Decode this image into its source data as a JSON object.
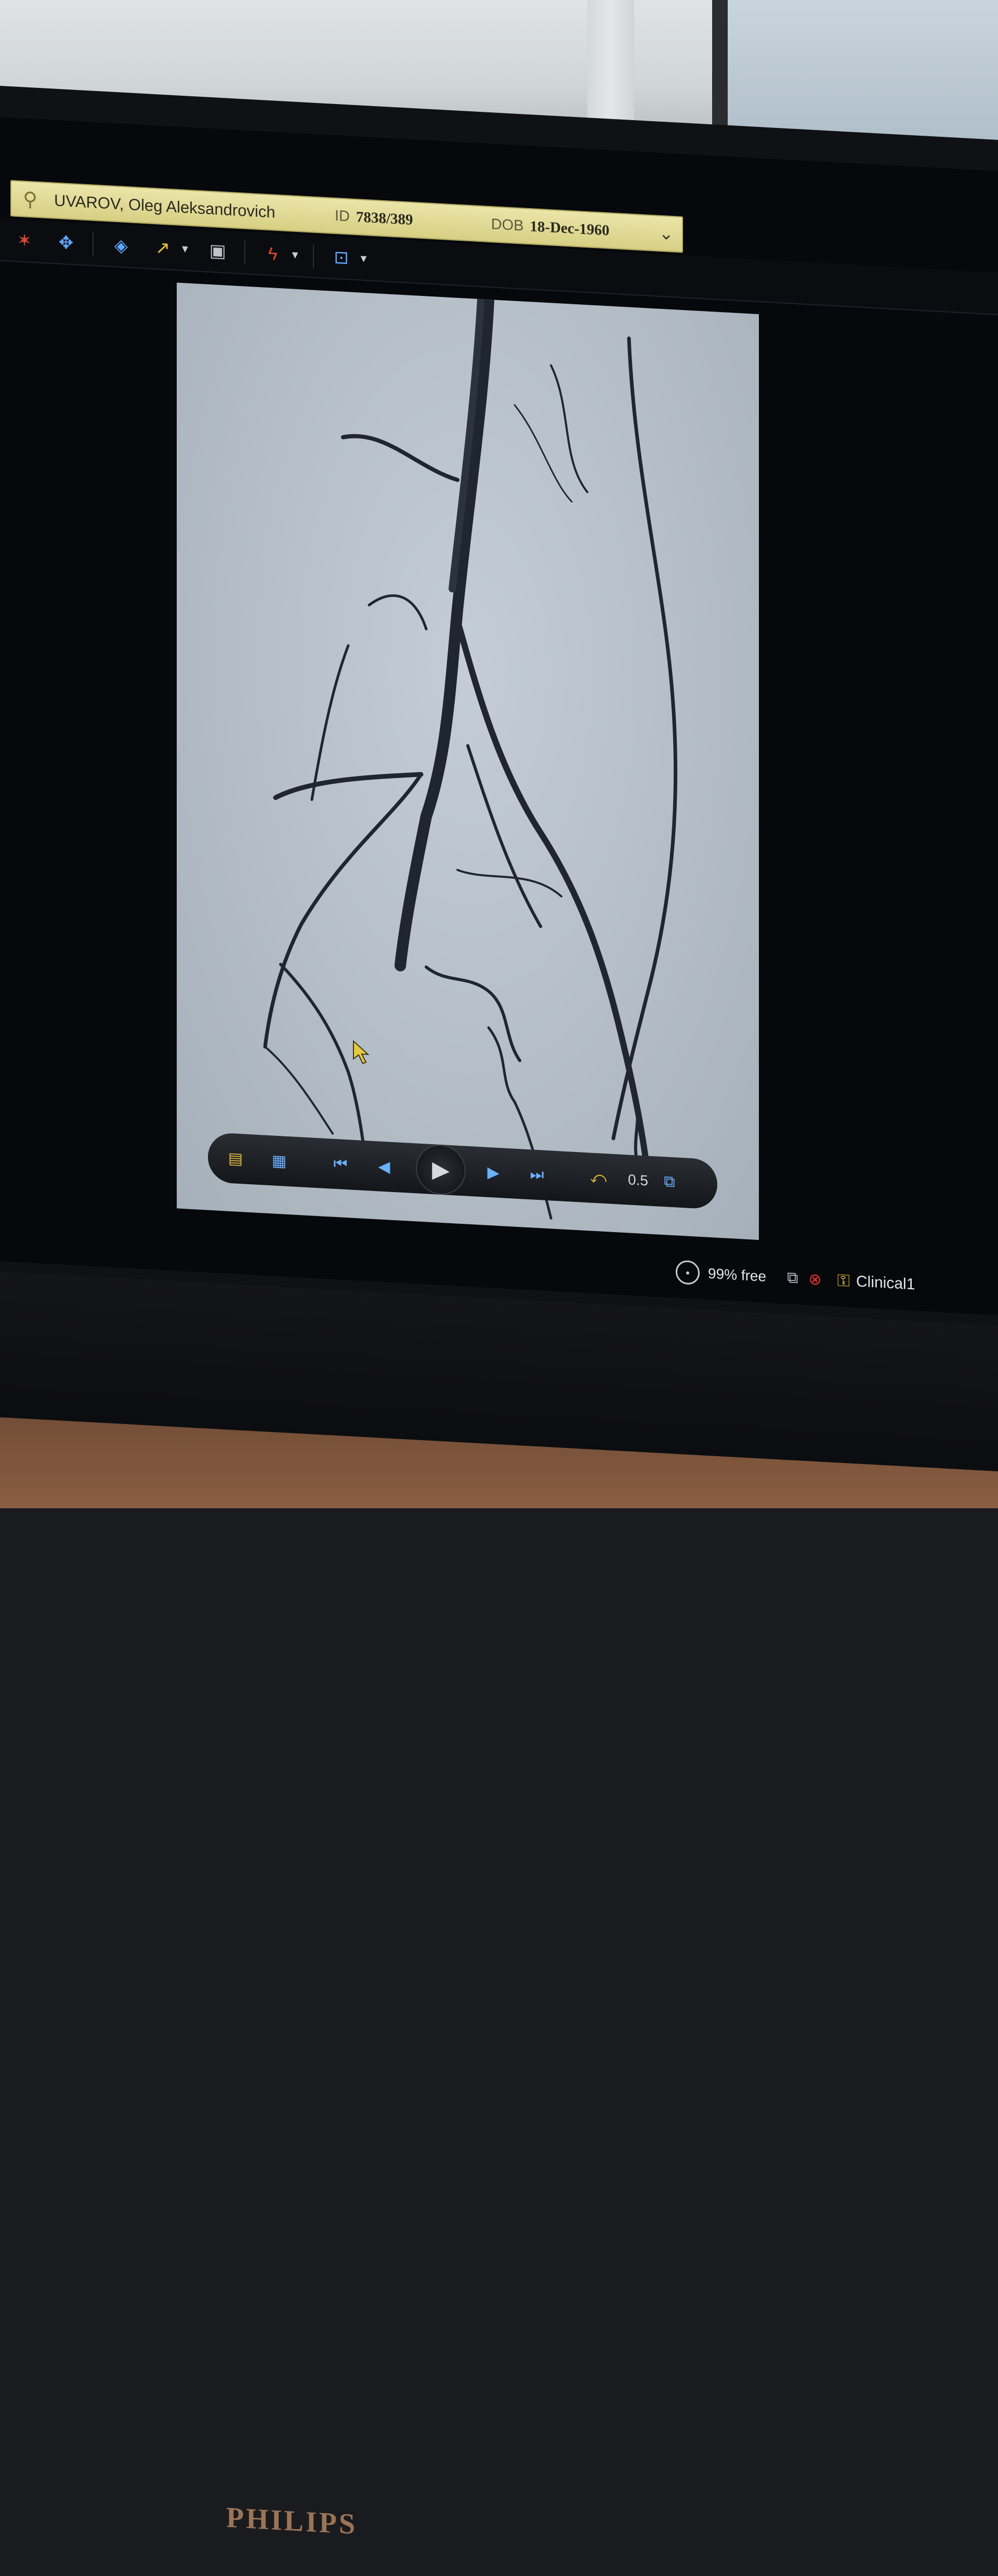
{
  "patient": {
    "name": "UVAROV, Oleg Aleksandrovich",
    "id_label": "ID",
    "id_value": "7838/389",
    "dob_label": "DOB",
    "dob_value": "18-Dec-1960"
  },
  "toolbar": {
    "tools": [
      "anatomy-icon",
      "move-icon",
      "annotation-icon",
      "arrow-icon",
      "camera-icon",
      "subtraction-icon",
      "zoom-icon"
    ]
  },
  "cine": {
    "speed": "0.5"
  },
  "status": {
    "disk": "99% free",
    "user": "Clinical1"
  },
  "brand": "PHILIPS",
  "colors": {
    "patient_bar": "#e3dc98",
    "toolbar_accent": "#5fa8ff",
    "tool_yellow": "#e9c23a",
    "error_red": "#e2342b"
  }
}
